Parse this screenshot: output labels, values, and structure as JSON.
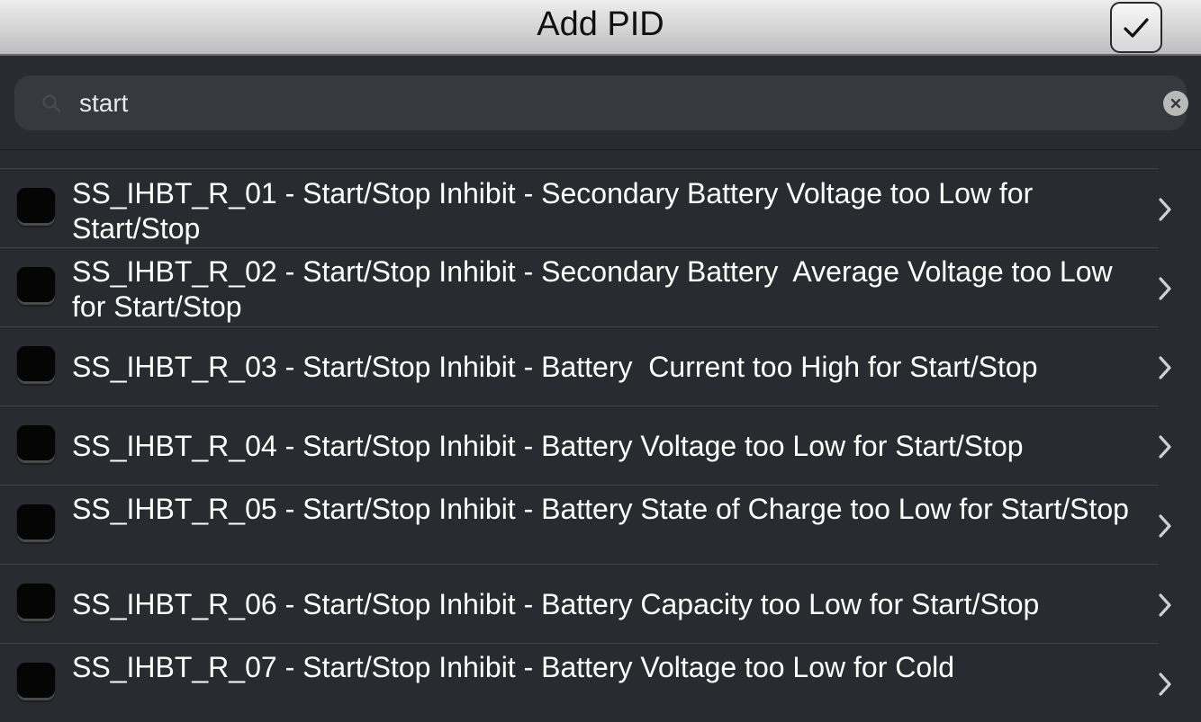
{
  "header": {
    "title": "Add PID",
    "done_icon": "checkmark-icon"
  },
  "search": {
    "value": "start",
    "icon": "search-icon",
    "clear_icon": "clear-icon"
  },
  "list": {
    "items": [
      {
        "label": "SS_IHBT_R_01 - Start/Stop Inhibit - Secondary Battery Voltage too Low for Start/Stop",
        "checked": false
      },
      {
        "label": "SS_IHBT_R_02 - Start/Stop Inhibit - Secondary Battery  Average Voltage too Low for Start/Stop",
        "checked": false
      },
      {
        "label": "SS_IHBT_R_03 - Start/Stop Inhibit - Battery  Current too High for Start/Stop",
        "checked": false
      },
      {
        "label": "SS_IHBT_R_04 - Start/Stop Inhibit - Battery Voltage too Low for Start/Stop",
        "checked": false
      },
      {
        "label": "SS_IHBT_R_05 - Start/Stop Inhibit - Battery State of Charge too Low for Start/Stop",
        "checked": false
      },
      {
        "label": "SS_IHBT_R_06 - Start/Stop Inhibit - Battery Capacity too Low for Start/Stop",
        "checked": false
      },
      {
        "label": "SS_IHBT_R_07 - Start/Stop Inhibit - Battery Voltage too Low for Cold",
        "checked": false
      }
    ]
  }
}
